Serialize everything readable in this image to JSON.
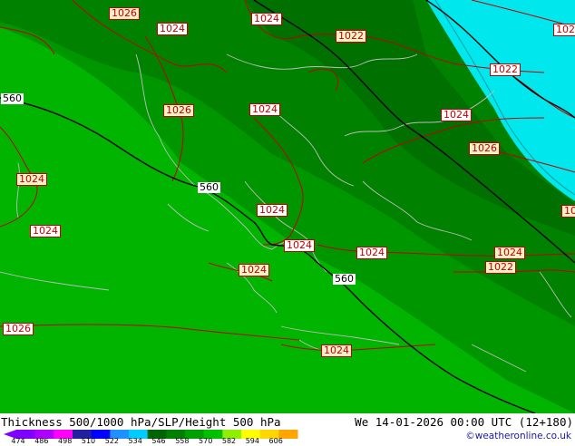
{
  "map": {
    "colors": {
      "band_534": "#00a000",
      "band_546": "#00b400",
      "band_522": "#009600",
      "band_high": "#008200",
      "band_highest": "#007000",
      "sea_cold": "#00e8ee",
      "coast": "#bcbcbc",
      "isobar": "#c00000",
      "thickness_line": "#000000"
    },
    "isobar_labels": [
      {
        "text": "1026",
        "kind": "hi"
      },
      {
        "text": "1024",
        "kind": "lo"
      },
      {
        "text": "1024",
        "kind": "lo"
      },
      {
        "text": "1022",
        "kind": "hi"
      },
      {
        "text": "102",
        "kind": "lo"
      },
      {
        "text": "1026",
        "kind": "hi"
      },
      {
        "text": "1024",
        "kind": "lo"
      },
      {
        "text": "1022",
        "kind": "lo"
      },
      {
        "text": "1024",
        "kind": "lo"
      },
      {
        "text": "1026",
        "kind": "hi"
      },
      {
        "text": "1024",
        "kind": "hi"
      },
      {
        "text": "1024",
        "kind": "lo"
      },
      {
        "text": "1024",
        "kind": "lo"
      },
      {
        "text": "1024",
        "kind": "lo"
      },
      {
        "text": "1024",
        "kind": "lo"
      },
      {
        "text": "1024",
        "kind": "hi"
      },
      {
        "text": "1024",
        "kind": "hi"
      },
      {
        "text": "1022",
        "kind": "hi"
      },
      {
        "text": "1026",
        "kind": "lo"
      },
      {
        "text": "1024",
        "kind": "hi"
      },
      {
        "text": "10",
        "kind": "hi"
      }
    ],
    "thickness_labels": [
      "560",
      "560",
      "560"
    ]
  },
  "footer": {
    "title": "Thickness 500/1000 hPa/SLP/Height 500 hPa",
    "datetime": "We 14-01-2026 00:00 UTC (12+180)",
    "credit": "©weatheronline.co.uk",
    "legend": {
      "values": [
        "474",
        "486",
        "498",
        "510",
        "522",
        "534",
        "546",
        "558",
        "570",
        "582",
        "594",
        "606"
      ],
      "colors": [
        "#8000ff",
        "#b000ff",
        "#ff00ff",
        "#2020a0",
        "#0000ff",
        "#1e90ff",
        "#00ccff",
        "#006400",
        "#008000",
        "#00a000",
        "#00c000",
        "#90ee00",
        "#ffff00",
        "#ffd700",
        "#ffa500"
      ]
    }
  }
}
